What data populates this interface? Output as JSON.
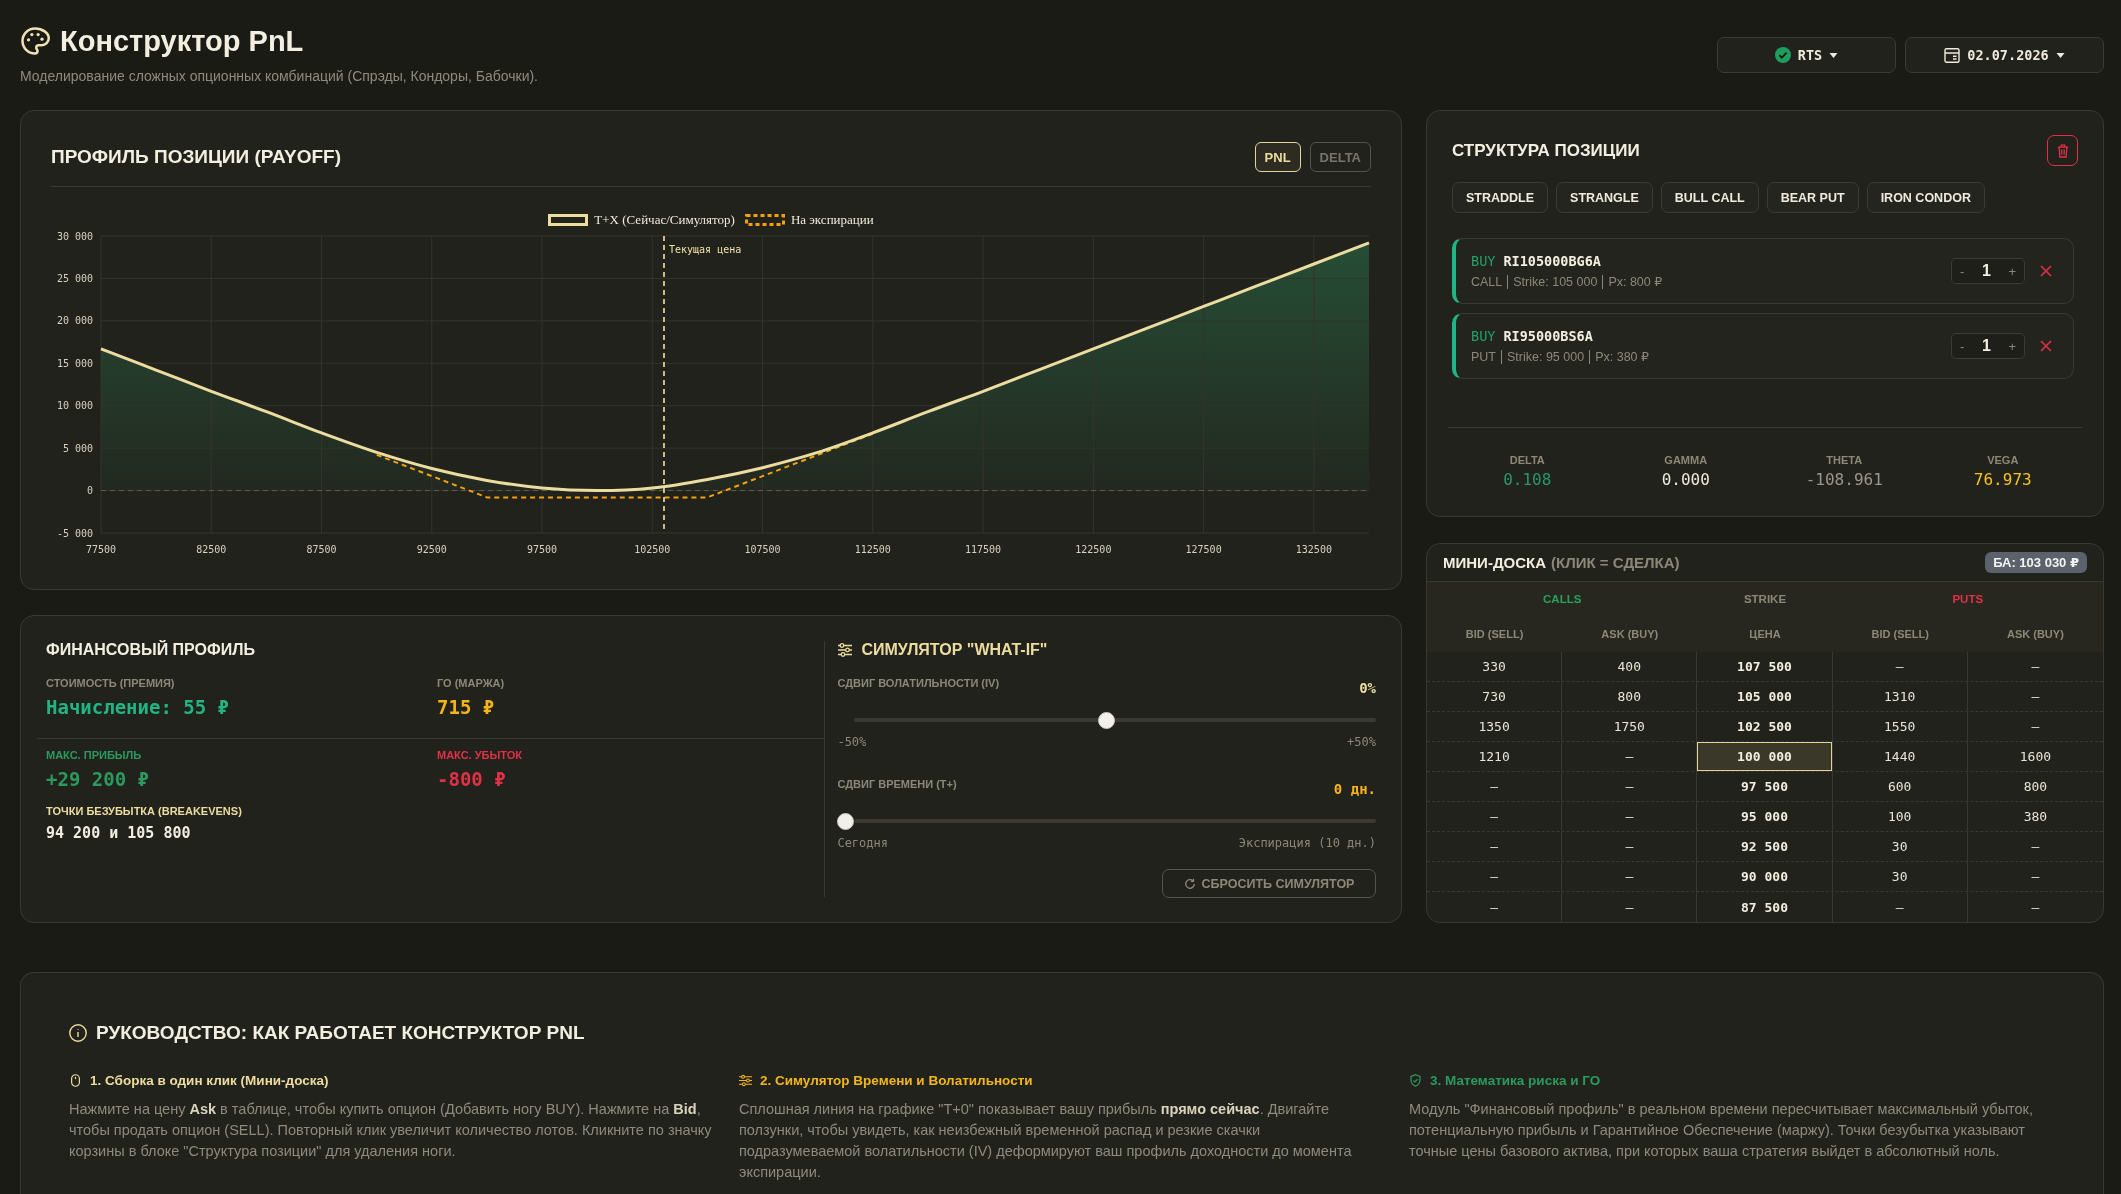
{
  "header": {
    "title": "Конструктор PnL",
    "subtitle": "Моделирование сложных опционных комбинаций (Спрэды, Кондоры, Бабочки).",
    "asset": "RTS",
    "date": "02.07.2026"
  },
  "payoff": {
    "title": "ПРОФИЛЬ ПОЗИЦИИ (PAYOFF)",
    "modes": [
      {
        "label": "PNL",
        "selected": true
      },
      {
        "label": "DELTA",
        "selected": false
      }
    ],
    "chart_data": {
      "type": "line",
      "x": [
        77500,
        80000,
        82500,
        85000,
        87500,
        90000,
        92500,
        95000,
        97500,
        100000,
        102500,
        105000,
        107500,
        110000,
        112500,
        115000,
        117500,
        120000,
        122500,
        125000,
        127500,
        130000,
        132500,
        135000
      ],
      "series": [
        {
          "name": "T+X (Сейчас/Симулятор)",
          "type": "area",
          "color": "#ecdca0",
          "line_style": "solid",
          "values": [
            16700,
            14200,
            11700,
            9300,
            6800,
            4500,
            2600,
            1200,
            300,
            0,
            300,
            1300,
            2700,
            4500,
            6800,
            9300,
            11700,
            14200,
            16700,
            19200,
            21700,
            24200,
            26700,
            29200
          ]
        },
        {
          "name": "На экспирации",
          "type": "line",
          "color": "#f5a00f",
          "line_style": "dashed",
          "values": [
            null,
            null,
            null,
            null,
            null,
            4200,
            1700,
            -800,
            -800,
            -800,
            -800,
            -800,
            1700,
            4200,
            6700,
            null,
            null,
            null,
            null,
            null,
            null,
            null,
            null,
            null
          ]
        }
      ],
      "xlim": [
        77500,
        135000
      ],
      "ylim": [
        -5000,
        30000
      ],
      "xticks": [
        77500,
        82500,
        87500,
        92500,
        97500,
        102500,
        107500,
        112500,
        117500,
        122500,
        127500,
        132500
      ],
      "yticks": [
        {
          "value": -5000,
          "label": "-5 000"
        },
        {
          "value": 0,
          "label": "0"
        },
        {
          "value": 5000,
          "label": "5 000"
        },
        {
          "value": 10000,
          "label": "10 000"
        },
        {
          "value": 15000,
          "label": "15 000"
        },
        {
          "value": 20000,
          "label": "20 000"
        },
        {
          "value": 25000,
          "label": "25 000"
        },
        {
          "value": 30000,
          "label": "30 000"
        }
      ],
      "grid": true,
      "legend": "top",
      "ref_lines": [
        {
          "axis": "y",
          "value": 0,
          "color": "#625e4e",
          "line_style": "dashed"
        },
        {
          "axis": "x",
          "value": 103030,
          "label": "Текущая цена",
          "color": "#f0e2a8",
          "line_style": "dashed"
        }
      ]
    }
  },
  "structure": {
    "title": "СТРУКТУРА ПОЗИЦИИ",
    "presets": [
      "STRADDLE",
      "STRANGLE",
      "BULL CALL",
      "BEAR PUT",
      "IRON CONDOR"
    ],
    "legs": [
      {
        "side": "BUY",
        "long": true,
        "ticker": "RI105000BG6A",
        "details": [
          "CALL",
          "Strike: 105 000",
          "Px: 800 ₽"
        ],
        "decrement": "-",
        "quantity": "1",
        "increment": "+"
      },
      {
        "side": "BUY",
        "long": true,
        "ticker": "RI95000BS6A",
        "details": [
          "PUT",
          "Strike: 95 000",
          "Px: 380 ₽"
        ],
        "decrement": "-",
        "quantity": "1",
        "increment": "+"
      }
    ],
    "greeks": [
      {
        "name": "DELTA",
        "value": "0.108",
        "color": "#28976a"
      },
      {
        "name": "GAMMA",
        "value": "0.000",
        "color": "#efebdc"
      },
      {
        "name": "THETA",
        "value": "-108.961",
        "color": "#9a968a"
      },
      {
        "name": "VEGA",
        "value": "76.973",
        "color": "#f6c21a"
      }
    ]
  },
  "financial": {
    "title": "ФИНАНСОВЫЙ ПРОФИЛЬ",
    "groups": [
      {
        "stats": [
          {
            "kind": "muted",
            "label": "СТОИМОСТЬ (ПРЕМИЯ)",
            "value": "Начисление: 55 ₽",
            "color": "#1fb585"
          },
          {
            "kind": "muted",
            "label": "ГО (МАРЖА)",
            "value": "715 ₽",
            "color": "#f6b416"
          }
        ]
      },
      {
        "stats": [
          {
            "kind": "tinted",
            "label": "МАКС. ПРИБЫЛЬ",
            "value": "+29 200 ₽",
            "color": "#2a9a5e"
          },
          {
            "kind": "tinted",
            "label": "МАКС. УБЫТОК",
            "value": "-800 ₽",
            "color": "#e03147"
          },
          {
            "kind": "plain",
            "label": "ТОЧКИ БЕЗУБЫТКА (BREAKEVENS)",
            "value": "94 200 и 105 800"
          }
        ]
      }
    ]
  },
  "simulator": {
    "title": "СИМУЛЯТОР \"WHAT-IF\"",
    "sliders": [
      {
        "label": "СДВИГ ВОЛАТИЛЬНОСТИ (IV)",
        "reading": "0%",
        "color": "#ecdca0",
        "level": 0.5,
        "min_label": "-50%",
        "max_label": "+50%"
      },
      {
        "label": "СДВИГ ВРЕМЕНИ (T+)",
        "reading": "0 дн.",
        "color": "#f6b416",
        "level": 0,
        "min_label": "Сегодня",
        "max_label": "Экспирация (10 дн.)"
      }
    ],
    "reset": "СБРОСИТЬ СИМУЛЯТОР"
  },
  "mini_board": {
    "title": "МИНИ-ДОСКА",
    "hint": "(КЛИК = СДЕЛКА)",
    "badge": "БА: 103 030 ₽",
    "groups": [
      {
        "label": "CALLS",
        "color": "#24a35f",
        "columns": [
          "BID (SELL)",
          "ASK (BUY)"
        ]
      },
      {
        "label": "STRIKE",
        "color": "#8c8878",
        "columns": [
          "ЦЕНА"
        ]
      },
      {
        "label": "PUTS",
        "color": "#e03147",
        "columns": [
          "BID (SELL)",
          "ASK (BUY)"
        ]
      }
    ],
    "rows": [
      {
        "calls": [
          "330",
          "400"
        ],
        "strike": "107 500",
        "puts": [
          "—",
          "—"
        ],
        "highlighted": false
      },
      {
        "calls": [
          "730",
          "800"
        ],
        "strike": "105 000",
        "puts": [
          "1310",
          "—"
        ],
        "highlighted": false
      },
      {
        "calls": [
          "1350",
          "1750"
        ],
        "strike": "102 500",
        "puts": [
          "1550",
          "—"
        ],
        "highlighted": false
      },
      {
        "calls": [
          "1210",
          "—"
        ],
        "strike": "100 000",
        "puts": [
          "1440",
          "1600"
        ],
        "highlighted": true
      },
      {
        "calls": [
          "—",
          "—"
        ],
        "strike": "97 500",
        "puts": [
          "600",
          "800"
        ],
        "highlighted": false
      },
      {
        "calls": [
          "—",
          "—"
        ],
        "strike": "95 000",
        "puts": [
          "100",
          "380"
        ],
        "highlighted": false
      },
      {
        "calls": [
          "—",
          "—"
        ],
        "strike": "92 500",
        "puts": [
          "30",
          "—"
        ],
        "highlighted": false
      },
      {
        "calls": [
          "—",
          "—"
        ],
        "strike": "90 000",
        "puts": [
          "30",
          "—"
        ],
        "highlighted": false
      },
      {
        "calls": [
          "—",
          "—"
        ],
        "strike": "87 500",
        "puts": [
          "—",
          "—"
        ],
        "highlighted": false
      }
    ]
  },
  "guide": {
    "title": "РУКОВОДСТВО: КАК РАБОТАЕТ КОНСТРУКТОР PNL",
    "sections": [
      {
        "kind": "mouse",
        "title": "1. Сборка в один клик (Мини-доска)",
        "color": "#ecdca0",
        "text": "Нажмите на цену **Ask** в таблице, чтобы купить опцион (Добавить ногу BUY). Нажмите на **Bid**, чтобы продать опцион (SELL). Повторный клик увеличит количество лотов. Кликните по значку корзины в блоке \"Структура позиции\" для удаления ноги."
      },
      {
        "kind": "sliders",
        "title": "2. Симулятор Времени и Волатильности",
        "color": "#f3b61c",
        "text": "Сплошная линия на графике \"T+0\" показывает вашу прибыль **прямо сейчас**. Двигайте ползунки, чтобы увидеть, как неизбежный временной распад и резкие скачки подразумеваемой волатильности (IV) деформируют ваш профиль доходности до момента экспирации."
      },
      {
        "kind": "shield",
        "title": "3. Математика риска и ГО",
        "color": "#2a9a5e",
        "text": "Модуль \"Финансовый профиль\" в реальном времени пересчитывает максимальный убыток, потенциальную прибыль и Гарантийное Обеспечение (маржу). Точки безубытка указывают точные цены базового актива, при которых ваша стратегия выйдет в абсолютный ноль."
      }
    ]
  }
}
